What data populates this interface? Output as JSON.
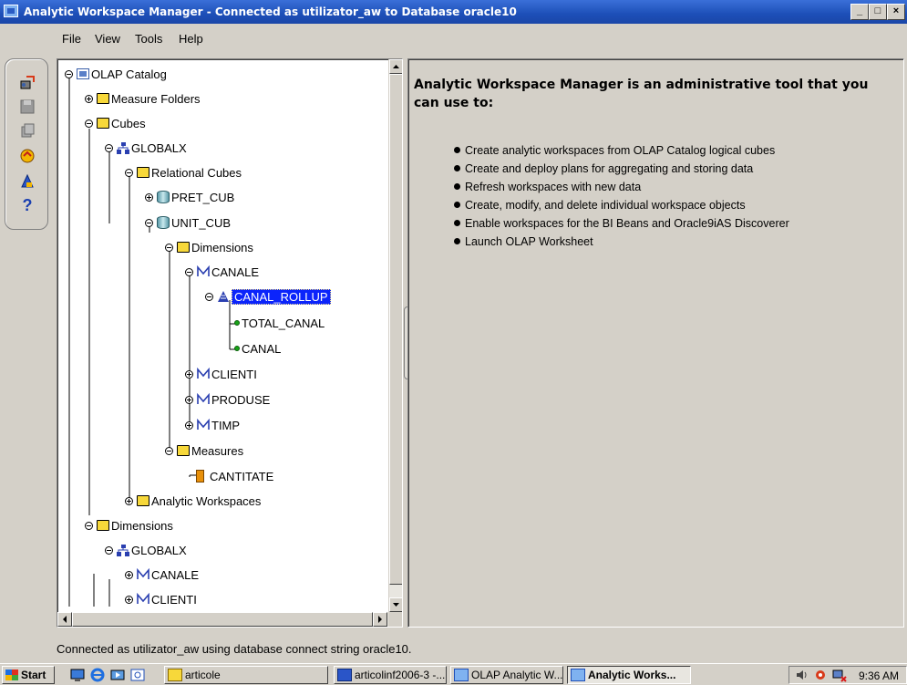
{
  "window": {
    "title": "Analytic Workspace Manager - Connected as utilizator_aw to Database oracle10",
    "min": "_",
    "max": "□",
    "close": "×"
  },
  "menu": [
    {
      "label": "File"
    },
    {
      "label": "View"
    },
    {
      "label": "Tools"
    },
    {
      "label": "Help"
    }
  ],
  "toolbar": {
    "icons": [
      "connect-icon",
      "save-icon",
      "copy-icon",
      "reload-icon",
      "wizard-icon",
      "help-icon"
    ],
    "help_label": "?"
  },
  "tree": {
    "nodes": [
      {
        "label": "OLAP Catalog"
      },
      {
        "label": "Measure Folders"
      },
      {
        "label": "Cubes"
      },
      {
        "label": "GLOBALX"
      },
      {
        "label": "Relational Cubes"
      },
      {
        "label": "PRET_CUB"
      },
      {
        "label": "UNIT_CUB"
      },
      {
        "label": "Dimensions"
      },
      {
        "label": "CANALE"
      },
      {
        "label": "CANAL_ROLLUP"
      },
      {
        "label": "TOTAL_CANAL"
      },
      {
        "label": "CANAL"
      },
      {
        "label": "CLIENTI"
      },
      {
        "label": "PRODUSE"
      },
      {
        "label": "TIMP"
      },
      {
        "label": "Measures"
      },
      {
        "label": "CANTITATE"
      },
      {
        "label": "Analytic Workspaces"
      },
      {
        "label": "Dimensions"
      },
      {
        "label": "GLOBALX"
      },
      {
        "label": "CANALE"
      },
      {
        "label": "CLIENTI"
      }
    ]
  },
  "info": {
    "title": "Analytic Workspace Manager is an administrative tool that you can use to:",
    "items": [
      "Create analytic workspaces from OLAP Catalog logical cubes",
      "Create and deploy plans for aggregating and storing data",
      "Refresh workspaces with new data",
      "Create, modify, and delete individual workspace objects",
      "Enable workspaces for the BI Beans and Oracle9iAS Discoverer",
      "Launch OLAP Worksheet"
    ]
  },
  "status": "Connected as utilizator_aw using database connect string oracle10.",
  "taskbar": {
    "start": "Start",
    "buttons": [
      "articole",
      "articolinf2006-3 -...",
      "OLAP Analytic W...",
      "Analytic Works..."
    ],
    "clock": "9:36 AM"
  }
}
